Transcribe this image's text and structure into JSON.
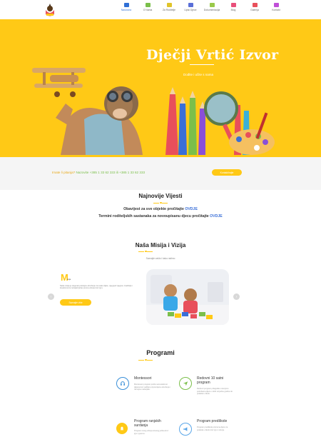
{
  "nav": {
    "items": [
      {
        "label": "Naslovna",
        "color": "#2f6fd6"
      },
      {
        "label": "O Nama",
        "color": "#7bbf4a"
      },
      {
        "label": "Za Roditelje",
        "color": "#e0c42a"
      },
      {
        "label": "Upisi Djece",
        "color": "#5a6fd8"
      },
      {
        "label": "Dokumentacija",
        "color": "#9ac94a"
      },
      {
        "label": "Blog",
        "color": "#e84f7a"
      },
      {
        "label": "Galerija",
        "color": "#e8505b"
      },
      {
        "label": "Kontakt",
        "color": "#c04fd8"
      }
    ]
  },
  "hero": {
    "title": "Dječji Vrtić Izvor",
    "subtitle": "Dođite i učite s nama"
  },
  "contact": {
    "question": "Imate li pitanja?",
    "call": "Nazovite",
    "phone1": "+385 1 33 62 333",
    "or": "ili",
    "phone2": "+385 1 33 62 333",
    "button": "Kontaktirajte"
  },
  "news": {
    "title": "Najnovije Vijesti",
    "line1_text": "Obavijest za sve objekte pročitajte",
    "line1_link": "OVDJE",
    "line2_text": "Termini roditeljskih sastanaka za novoupisanu djecu pročitajte",
    "line2_link": "OVDJE"
  },
  "mission": {
    "title": "Naša Misija i Vizija",
    "subtitle": "Saznajte zašto i kako radimo",
    "letter": "M",
    "card_subtitle": "isija",
    "text": "Naša misija je osigurati poticajno okruženje za svako dijete, njegujući njegovu znatiželju i kreativnost te razvijati ljubav prema učenju kroz igru.",
    "button": "Saznajte više",
    "prev": "‹",
    "next": "›"
  },
  "programs": {
    "title": "Programi",
    "items": [
      {
        "title": "Montessori",
        "desc": "Montessori program potiče samostalnost djeteta kroz pažljivo pripremljeno okruženje i razvojne materijale.",
        "color": "#3a8fd8",
        "icon": "headset-icon"
      },
      {
        "title": "Redovni 10 satni program",
        "desc": "Redovni program prilagođen razvojnim potrebama djece u dobi od jedne godine do polaska u školu.",
        "color": "#7bbf4a",
        "icon": "send-icon"
      },
      {
        "title": "Program ranjskih surdanja",
        "desc": "Program ranog učenja stranog jezika kroz igru i pjesmu.",
        "color": "#ffc916",
        "icon": "bell-icon"
      },
      {
        "title": "Program predškole",
        "desc": "Program predškole priprema djecu za polazak u školu kroz igru i učenje.",
        "color": "#5aa6e8",
        "icon": "megaphone-icon"
      }
    ]
  }
}
